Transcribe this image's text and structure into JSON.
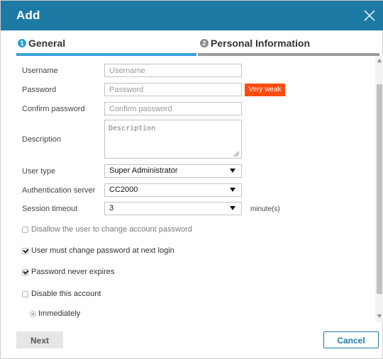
{
  "dialog": {
    "title": "Add",
    "close_icon": "close-icon"
  },
  "steps": [
    {
      "number": "1",
      "label": "General",
      "active": true,
      "color": "#2a9fd8"
    },
    {
      "number": "2",
      "label": "Personal Information",
      "active": false,
      "color": "#8c8c8c"
    }
  ],
  "form": {
    "username": {
      "label": "Username",
      "value": "",
      "placeholder": "Username"
    },
    "password": {
      "label": "Password",
      "value": "",
      "placeholder": "Password",
      "strength": "Very weak",
      "strength_color": "#ff4b0f"
    },
    "confirm_password": {
      "label": "Confirm password",
      "value": "",
      "placeholder": "Confirm password"
    },
    "description": {
      "label": "Description",
      "value": "",
      "placeholder": "Description"
    },
    "user_type": {
      "label": "User type",
      "value": "Super Administrator"
    },
    "auth_server": {
      "label": "Authentication server",
      "value": "CC2000"
    },
    "session_timeout": {
      "label": "Session timeout",
      "value": "3",
      "unit": "minute(s)"
    },
    "checkboxes": [
      {
        "label": "Disallow the user to change account password",
        "checked": false,
        "enabled": false
      },
      {
        "label": "User must change password at next login",
        "checked": true,
        "enabled": true
      },
      {
        "label": "Password never expires",
        "checked": true,
        "enabled": true
      },
      {
        "label": "Disable this account",
        "checked": false,
        "enabled": true
      }
    ],
    "disable_option": {
      "label": "Immediately",
      "selected": true,
      "enabled": false
    }
  },
  "footer": {
    "next_label": "Next",
    "cancel_label": "Cancel"
  },
  "colors": {
    "titlebar": "#1c7aa5",
    "accent": "#3aa3d8",
    "inactive_step": "#9a9a9a"
  }
}
